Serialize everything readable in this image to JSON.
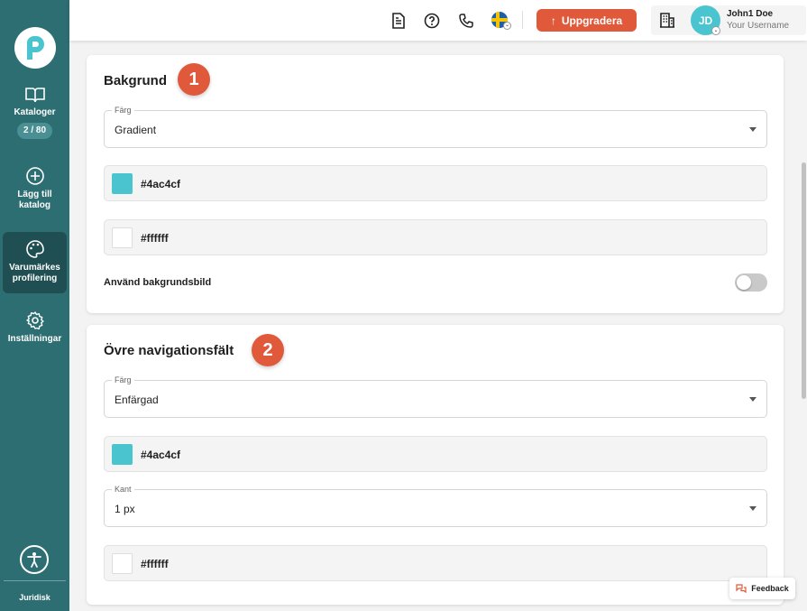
{
  "sidebar": {
    "items": [
      {
        "label": "Kataloger",
        "badge": "2 / 80",
        "icon": "book-icon"
      },
      {
        "label": "Lägg till katalog",
        "icon": "plus-circle-icon"
      },
      {
        "label": "Varumärkes profilering",
        "icon": "palette-icon",
        "active": true
      },
      {
        "label": "Inställningar",
        "icon": "gear-icon"
      }
    ],
    "footer_label": "Juridisk"
  },
  "header": {
    "upgrade_label": "Uppgradera",
    "user": {
      "initials": "JD",
      "name": "John1 Doe",
      "subtitle": "Your Username"
    }
  },
  "sections": {
    "background": {
      "title": "Bakgrund",
      "step": "1",
      "color_select": {
        "legend": "Färg",
        "value": "Gradient"
      },
      "color1": "#4ac4cf",
      "color2": "#ffffff",
      "bg_image_label": "Använd bakgrundsbild",
      "bg_image_enabled": false
    },
    "topnav": {
      "title": "Övre navigationsfält",
      "step": "2",
      "color_select": {
        "legend": "Färg",
        "value": "Enfärgad"
      },
      "color1": "#4ac4cf",
      "border_select": {
        "legend": "Kant",
        "value": "1 px"
      },
      "border_color": "#ffffff"
    }
  },
  "feedback_label": "Feedback",
  "colors": {
    "sidebar": "#2d6e72",
    "accent": "#e0593b",
    "teal": "#4ac4cf"
  }
}
